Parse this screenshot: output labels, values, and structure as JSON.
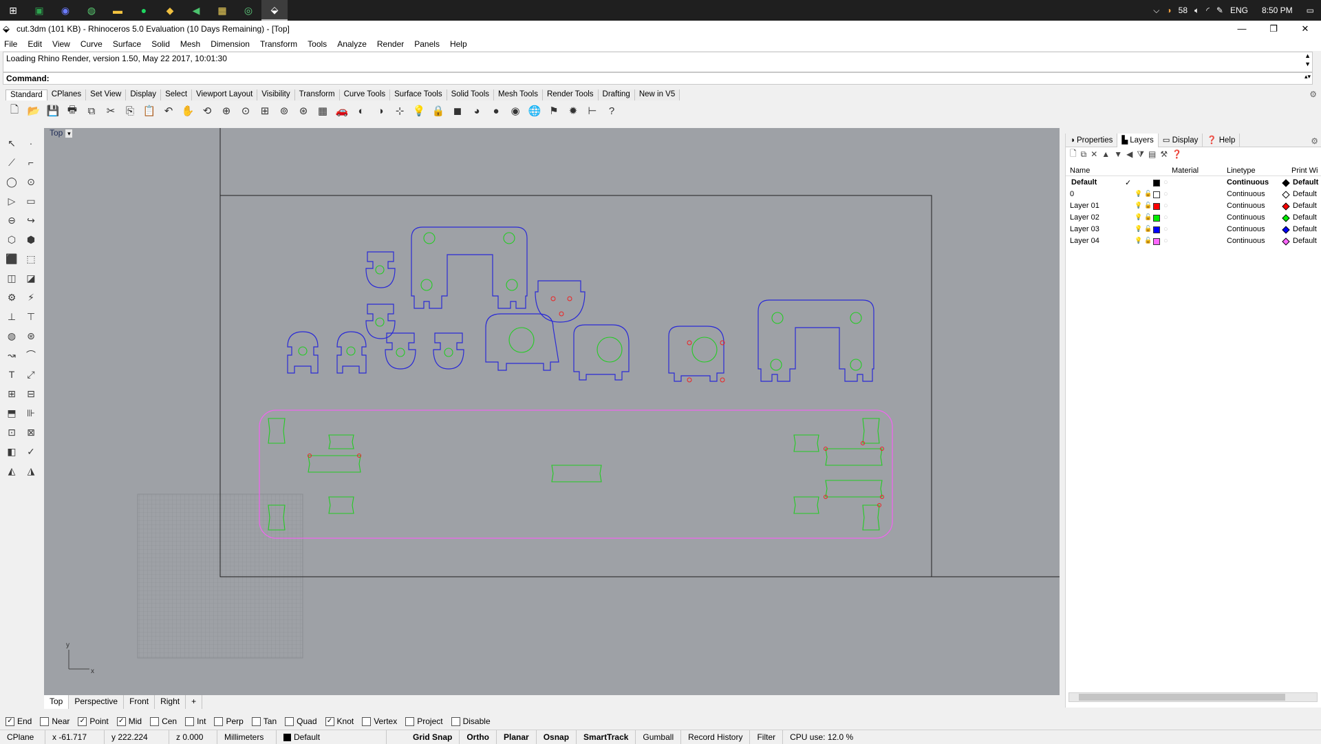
{
  "taskbar": {
    "apps": [
      "start-icon",
      "excel-icon",
      "firefox-icon",
      "chrome-icon",
      "folder-icon",
      "spotify-icon",
      "git-icon",
      "telegram-icon",
      "files-icon",
      "app-icon",
      "rhino-icon"
    ],
    "weather": "58",
    "lang": "ENG",
    "time": "8:50 PM"
  },
  "window": {
    "title": "cut.3dm (101 KB) - Rhinoceros 5.0 Evaluation (10 Days Remaining) - [Top]"
  },
  "menu": [
    "File",
    "Edit",
    "View",
    "Curve",
    "Surface",
    "Solid",
    "Mesh",
    "Dimension",
    "Transform",
    "Tools",
    "Analyze",
    "Render",
    "Panels",
    "Help"
  ],
  "history": "Loading Rhino Render, version 1.50, May 22 2017, 10:01:30",
  "command": {
    "label": "Command:"
  },
  "toolbar_tabs": [
    "Standard",
    "CPlanes",
    "Set View",
    "Display",
    "Select",
    "Viewport Layout",
    "Visibility",
    "Transform",
    "Curve Tools",
    "Surface Tools",
    "Solid Tools",
    "Mesh Tools",
    "Render Tools",
    "Drafting",
    "New in V5"
  ],
  "toolbar_icons": [
    "new-icon",
    "open-icon",
    "save-icon",
    "print-icon",
    "import-icon",
    "cut-icon",
    "copy-icon",
    "paste-icon",
    "undo-icon",
    "pan-icon",
    "rotate-icon",
    "zoom-window-icon",
    "zoom-dynamic-icon",
    "zoom-extents-icon",
    "zoom-selected-icon",
    "zoom-all-icon",
    "four-view-icon",
    "car-icon",
    "hide-icon",
    "show-icon",
    "object-snap-icon",
    "light-icon",
    "lock-icon",
    "material-icon",
    "color-icon",
    "shaded-icon",
    "rendered-icon",
    "render-sphere-icon",
    "options-icon",
    "grasshopper-icon",
    "dimension-icon",
    "help-icon"
  ],
  "viewport": {
    "label": "Top",
    "axis_x": "x",
    "axis_y": "y"
  },
  "viewport_tabs": [
    "Top",
    "Perspective",
    "Front",
    "Right",
    "+"
  ],
  "panel": {
    "tabs": [
      "Properties",
      "Layers",
      "Display",
      "Help"
    ],
    "columns": {
      "name": "Name",
      "material": "Material",
      "linetype": "Linetype",
      "print": "Print Wi"
    },
    "layers": [
      {
        "name": "Default",
        "check": "✓",
        "color": "#000000",
        "linetype": "Continuous",
        "print": "Default",
        "bold": true
      },
      {
        "name": "0",
        "check": "",
        "color": "#ffffff",
        "linetype": "Continuous",
        "print": "Default"
      },
      {
        "name": "Layer 01",
        "check": "",
        "color": "#ff0000",
        "linetype": "Continuous",
        "print": "Default"
      },
      {
        "name": "Layer 02",
        "check": "",
        "color": "#00ee00",
        "linetype": "Continuous",
        "print": "Default"
      },
      {
        "name": "Layer 03",
        "check": "",
        "color": "#0000ff",
        "linetype": "Continuous",
        "print": "Default"
      },
      {
        "name": "Layer 04",
        "check": "",
        "color": "#ff66ff",
        "linetype": "Continuous",
        "print": "Default"
      }
    ]
  },
  "osnap": [
    {
      "label": "End",
      "checked": true
    },
    {
      "label": "Near",
      "checked": false
    },
    {
      "label": "Point",
      "checked": true
    },
    {
      "label": "Mid",
      "checked": true
    },
    {
      "label": "Cen",
      "checked": false
    },
    {
      "label": "Int",
      "checked": false
    },
    {
      "label": "Perp",
      "checked": false
    },
    {
      "label": "Tan",
      "checked": false
    },
    {
      "label": "Quad",
      "checked": false
    },
    {
      "label": "Knot",
      "checked": true
    },
    {
      "label": "Vertex",
      "checked": false
    },
    {
      "label": "Project",
      "checked": false
    },
    {
      "label": "Disable",
      "checked": false
    }
  ],
  "status": {
    "cplane": "CPlane",
    "x": "x -61.717",
    "y": "y 222.224",
    "z": "z 0.000",
    "units": "Millimeters",
    "layer": "Default",
    "grid_snap": "Grid Snap",
    "ortho": "Ortho",
    "planar": "Planar",
    "osnap": "Osnap",
    "smarttrack": "SmartTrack",
    "gumball": "Gumball",
    "record_history": "Record History",
    "filter": "Filter",
    "cpu": "CPU use: 12.0 %"
  },
  "colors": {
    "viewport_bg": "#9ea1a6",
    "blue_curves": "#2a2ad6",
    "green_curves": "#22cc22",
    "magenta_curves": "#ee66ee",
    "red_points": "#ee2222"
  }
}
